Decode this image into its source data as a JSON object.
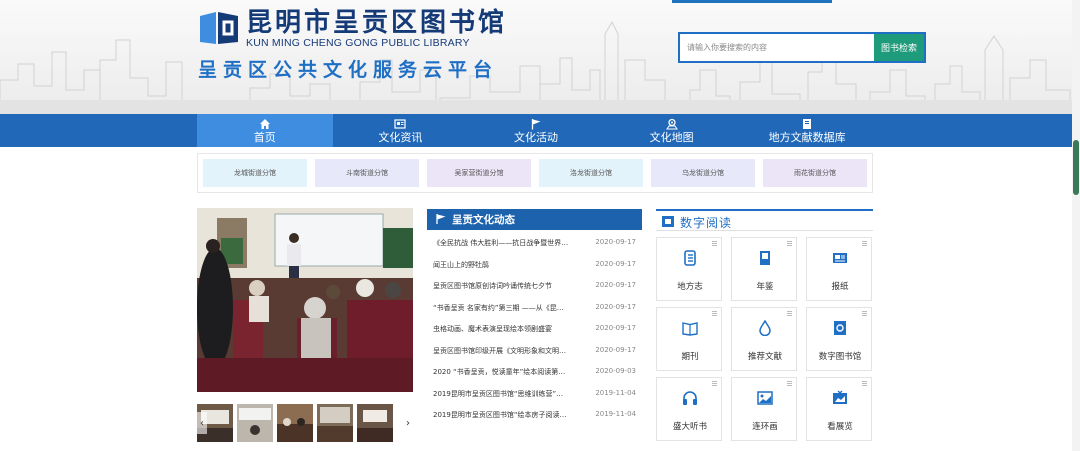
{
  "header": {
    "library_name": "昆明市呈贡区图书馆",
    "library_name_en": "KUN MING CHENG GONG PUBLIC LIBRARY",
    "platform_title": "呈贡区公共文化服务云平台",
    "search": {
      "placeholder": "请输入你要搜索的内容",
      "button_label": "图书检索"
    }
  },
  "nav": {
    "items": [
      {
        "label": "首页",
        "icon": "home-icon"
      },
      {
        "label": "文化资讯",
        "icon": "news-icon"
      },
      {
        "label": "文化活动",
        "icon": "flag-icon"
      },
      {
        "label": "文化地图",
        "icon": "map-icon"
      },
      {
        "label": "地方文献数据库",
        "icon": "database-icon"
      }
    ]
  },
  "branches": [
    {
      "label": "龙城街道分馆",
      "color": "#e3f3fb"
    },
    {
      "label": "斗南街道分馆",
      "color": "#e7e9fb"
    },
    {
      "label": "吴家营街道分馆",
      "color": "#ece5f8"
    },
    {
      "label": "洛龙街道分馆",
      "color": "#e3f3fb"
    },
    {
      "label": "乌龙街道分馆",
      "color": "#e7e9fb"
    },
    {
      "label": "雨花街道分馆",
      "color": "#ece5f8"
    }
  ],
  "news": {
    "title": "呈贡文化动态",
    "items": [
      {
        "text": "《全民抗战 伟大胜利——抗日战争暨世界…",
        "date": "2020-09-17"
      },
      {
        "text": "闻王山上的野牡鹃",
        "date": "2020-09-17"
      },
      {
        "text": "呈贡区图书馆原创诗词吟诵传统七夕节",
        "date": "2020-09-17"
      },
      {
        "text": "“书香呈贡 名家有约”第三期 ——从《昆…",
        "date": "2020-09-17"
      },
      {
        "text": "虫格动画、魔术表演呈现绘本领剧盛宴",
        "date": "2020-09-17"
      },
      {
        "text": "呈贡区图书馆印级开展《文明形象和文明…",
        "date": "2020-09-17"
      },
      {
        "text": "2020 “书香呈贡，悦读童年”绘本阅读第…",
        "date": "2020-09-03"
      },
      {
        "text": "2019昆明市呈贡区图书馆“思维训练营”…",
        "date": "2019-11-04"
      },
      {
        "text": "2019昆明市呈贡区图书馆“绘本房子阅读…",
        "date": "2019-11-04"
      }
    ]
  },
  "digital": {
    "title": "数字阅读",
    "items": [
      {
        "label": "地方志",
        "icon": "local-chronicle-icon"
      },
      {
        "label": "年鉴",
        "icon": "yearbook-icon"
      },
      {
        "label": "报纸",
        "icon": "newspaper-icon"
      },
      {
        "label": "期刊",
        "icon": "journal-icon"
      },
      {
        "label": "推荐文献",
        "icon": "recommend-icon"
      },
      {
        "label": "数字图书馆",
        "icon": "digital-library-icon"
      },
      {
        "label": "盛大听书",
        "icon": "headphones-icon"
      },
      {
        "label": "连环画",
        "icon": "comic-icon"
      },
      {
        "label": "看展览",
        "icon": "exhibition-icon"
      }
    ]
  },
  "colors": {
    "nav": "#2169b8",
    "nav_active": "#3f8de0",
    "accent": "#1f6fc4",
    "search_button": "#1e9b7a"
  }
}
